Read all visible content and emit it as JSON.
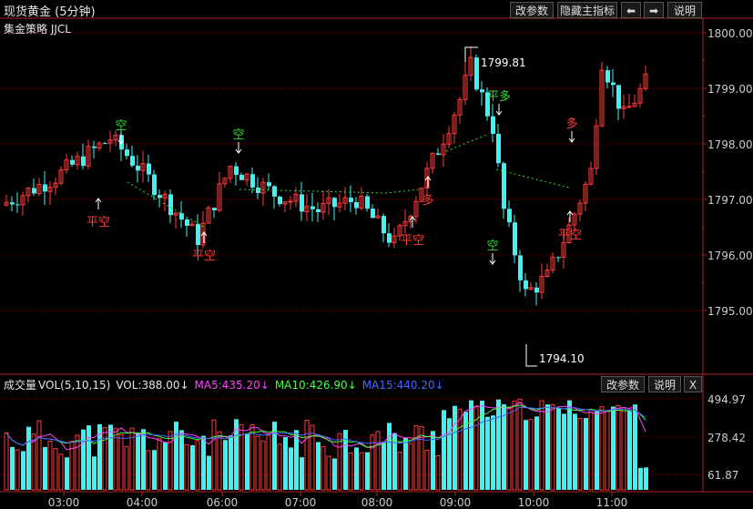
{
  "header": {
    "title": "现货黄金 (5分钟)",
    "strategy": "集金策略 JJCL",
    "buttons": {
      "params": "改参数",
      "hide": "隐藏主指标",
      "left": "⬅",
      "right": "➡",
      "help": "说明"
    }
  },
  "colors": {
    "up": "#ff3b3b",
    "down": "#3ff3f3",
    "grid": "#800000",
    "axis": "#b22222",
    "ma5": "#ff44ff",
    "ma10": "#44ff44",
    "ma15": "#4466ff",
    "signal_green": "#33dd33",
    "signal_red": "#ff3b3b"
  },
  "price_axis": {
    "labels": [
      "1800.00",
      "1799.00",
      "1798.00",
      "1797.00",
      "1796.00",
      "1795.00"
    ]
  },
  "annotations": {
    "high": "1799.81",
    "low": "1794.10"
  },
  "signals": [
    {
      "text": "空",
      "color": "green",
      "dir": "down"
    },
    {
      "text": "平空",
      "color": "red",
      "dir": "up"
    },
    {
      "text": "平空",
      "color": "red",
      "dir": "up"
    },
    {
      "text": "空",
      "color": "green",
      "dir": "down"
    },
    {
      "text": "平空",
      "color": "red",
      "dir": "up"
    },
    {
      "text": "多",
      "color": "red",
      "dir": "up"
    },
    {
      "text": "平多",
      "color": "green",
      "dir": "down"
    },
    {
      "text": "空",
      "color": "green",
      "dir": "down"
    },
    {
      "text": "多",
      "color": "red",
      "dir": "down"
    },
    {
      "text": "平空",
      "color": "red",
      "dir": "up"
    }
  ],
  "volume": {
    "label": "成交量",
    "vol_params": "VOL(5,10,15)",
    "vol": "VOL:388.00↓",
    "ma5": "MA5:435.20↓",
    "ma10": "MA10:426.90↓",
    "ma15": "MA15:440.20↓",
    "axis_labels": [
      "494.97",
      "278.42",
      "61.87"
    ],
    "buttons": {
      "params": "改参数",
      "help": "说明",
      "close": "X"
    }
  },
  "time_axis": [
    "03:00",
    "04:00",
    "06:00",
    "07:00",
    "08:00",
    "09:00",
    "10:00",
    "11:00"
  ]
}
